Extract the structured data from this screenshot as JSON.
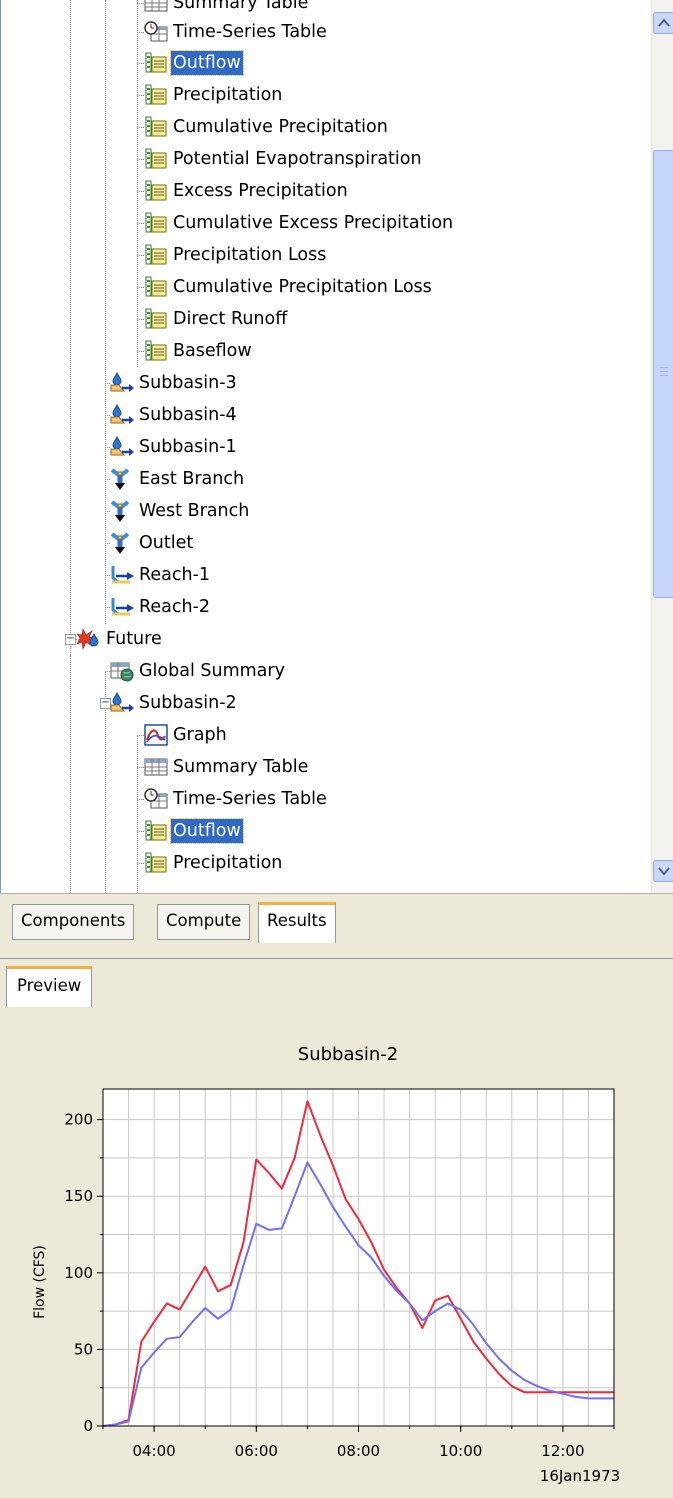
{
  "tree": {
    "rows": [
      {
        "label": "Summary Table",
        "icon": "summary-table-icon",
        "selected": false
      },
      {
        "label": "Time-Series Table",
        "icon": "time-series-table-icon",
        "selected": false
      },
      {
        "label": "Outflow",
        "icon": "time-series-icon",
        "selected": true
      },
      {
        "label": "Precipitation",
        "icon": "time-series-icon",
        "selected": false
      },
      {
        "label": "Cumulative Precipitation",
        "icon": "time-series-icon",
        "selected": false
      },
      {
        "label": "Potential Evapotranspiration",
        "icon": "time-series-icon",
        "selected": false
      },
      {
        "label": "Excess Precipitation",
        "icon": "time-series-icon",
        "selected": false
      },
      {
        "label": "Cumulative Excess Precipitation",
        "icon": "time-series-icon",
        "selected": false
      },
      {
        "label": "Precipitation Loss",
        "icon": "time-series-icon",
        "selected": false
      },
      {
        "label": "Cumulative Precipitation Loss",
        "icon": "time-series-icon",
        "selected": false
      },
      {
        "label": "Direct Runoff",
        "icon": "time-series-icon",
        "selected": false
      },
      {
        "label": "Baseflow",
        "icon": "time-series-icon",
        "selected": false
      },
      {
        "label": "Subbasin-3",
        "icon": "subbasin-icon",
        "selected": false
      },
      {
        "label": "Subbasin-4",
        "icon": "subbasin-icon",
        "selected": false
      },
      {
        "label": "Subbasin-1",
        "icon": "subbasin-icon",
        "selected": false
      },
      {
        "label": "East Branch",
        "icon": "junction-icon",
        "selected": false
      },
      {
        "label": "West Branch",
        "icon": "junction-icon",
        "selected": false
      },
      {
        "label": "Outlet",
        "icon": "junction-icon",
        "selected": false
      },
      {
        "label": "Reach-1",
        "icon": "reach-icon",
        "selected": false
      },
      {
        "label": "Reach-2",
        "icon": "reach-icon",
        "selected": false
      },
      {
        "label": "Future",
        "icon": "simulation-run-icon",
        "selected": false
      },
      {
        "label": "Global Summary",
        "icon": "global-summary-icon",
        "selected": false
      },
      {
        "label": "Subbasin-2",
        "icon": "subbasin-icon",
        "selected": false
      },
      {
        "label": "Graph",
        "icon": "graph-icon",
        "selected": false
      },
      {
        "label": "Summary Table",
        "icon": "summary-table-icon",
        "selected": false
      },
      {
        "label": "Time-Series Table",
        "icon": "time-series-table-icon",
        "selected": false
      },
      {
        "label": "Outflow",
        "icon": "time-series-icon",
        "selected": true
      },
      {
        "label": "Precipitation",
        "icon": "time-series-icon",
        "selected": false
      }
    ]
  },
  "tabs": {
    "items": [
      {
        "label": "Components",
        "active": false
      },
      {
        "label": "Compute",
        "active": false
      },
      {
        "label": "Results",
        "active": true
      }
    ]
  },
  "preview": {
    "tab_label": "Preview"
  },
  "chart_data": {
    "type": "line",
    "title": "Subbasin-2",
    "xlabel": "",
    "ylabel": "Flow (CFS)",
    "date_label": "16Jan1973",
    "x_ticks": [
      "04:00",
      "06:00",
      "08:00",
      "10:00",
      "12:00"
    ],
    "y_ticks": [
      "0",
      "50",
      "100",
      "150",
      "200"
    ],
    "xlim": [
      "03:00",
      "13:00"
    ],
    "ylim": [
      0,
      220
    ],
    "grid": true,
    "x": [
      "03:00",
      "03:15",
      "03:30",
      "03:45",
      "04:00",
      "04:15",
      "04:30",
      "04:45",
      "05:00",
      "05:15",
      "05:30",
      "05:45",
      "06:00",
      "06:15",
      "06:30",
      "06:45",
      "07:00",
      "07:15",
      "07:30",
      "07:45",
      "08:00",
      "08:15",
      "08:30",
      "08:45",
      "09:00",
      "09:15",
      "09:30",
      "09:45",
      "10:00",
      "10:15",
      "10:30",
      "10:45",
      "11:00",
      "11:15",
      "11:30",
      "11:45",
      "12:00",
      "12:15",
      "12:30",
      "12:45",
      "13:00"
    ],
    "series": [
      {
        "color": "#ee2b3b",
        "values": [
          0,
          1,
          4,
          55,
          68,
          80,
          76,
          90,
          104,
          88,
          92,
          120,
          174,
          165,
          155,
          175,
          212,
          190,
          170,
          148,
          135,
          120,
          102,
          90,
          80,
          64,
          82,
          85,
          70,
          55,
          44,
          34,
          26,
          22,
          22,
          22,
          22,
          22,
          22,
          22,
          22
        ]
      },
      {
        "color": "#7070ff",
        "values": [
          0,
          1,
          3,
          38,
          48,
          57,
          58,
          68,
          77,
          70,
          76,
          105,
          132,
          128,
          129,
          150,
          172,
          158,
          143,
          130,
          118,
          110,
          98,
          88,
          80,
          69,
          75,
          80,
          76,
          66,
          54,
          44,
          36,
          30,
          26,
          23,
          21,
          19,
          18,
          18,
          18
        ]
      }
    ]
  }
}
